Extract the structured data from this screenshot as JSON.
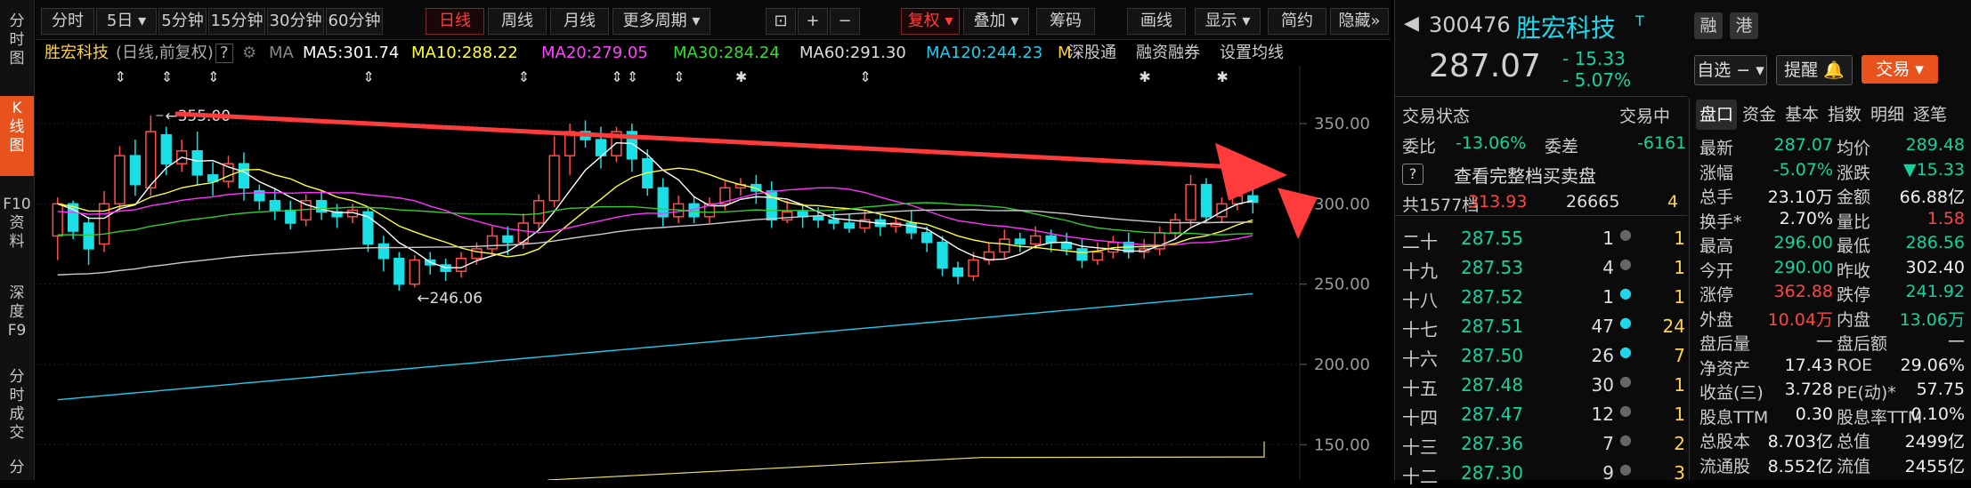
{
  "left_sidebar": [
    {
      "id": "fenshi",
      "label": [
        "分",
        "时",
        "图"
      ],
      "active": false
    },
    {
      "id": "kline",
      "label": [
        "K",
        "线",
        "图"
      ],
      "active": true
    },
    {
      "id": "f10",
      "label": [
        "F10",
        "资",
        "料"
      ],
      "active": false
    },
    {
      "id": "depth",
      "label": [
        "深",
        "度",
        "F9"
      ],
      "active": false
    },
    {
      "id": "deal",
      "label": [
        "分",
        "时",
        "成",
        "交"
      ],
      "active": false
    },
    {
      "id": "more",
      "label": [
        "分"
      ],
      "active": false
    }
  ],
  "toolbar": {
    "periods": [
      "分时",
      "5日",
      "5分钟",
      "15分钟",
      "30分钟",
      "60分钟",
      "日线",
      "周线",
      "月线",
      "更多周期"
    ],
    "active_period": "日线",
    "fuquan": "复权",
    "overlay": "叠加",
    "chips": "筹码",
    "draw": "画线",
    "display": "显示",
    "simplified": "简约",
    "hide": "隐藏"
  },
  "infobar": {
    "name": "胜宏科技",
    "mode": "(日线,前复权)",
    "help": "?",
    "ma_label": "MA",
    "ma5": "MA5:301.74",
    "ma10": "MA10:288.22",
    "ma20": "MA20:279.05",
    "ma30": "MA30:284.24",
    "ma60": "MA60:291.30",
    "ma120": "MA120:244.23",
    "ma_more": "M",
    "shengu": "深股通",
    "margin": "融资融券",
    "set_ma": "设置均线"
  },
  "chart_data": {
    "type": "candlestick",
    "y_ticks": [
      350.0,
      300.0,
      250.0,
      200.0,
      150.0
    ],
    "y_tick_labels": [
      "350.00",
      "300.00",
      "250.00",
      "200.00",
      "150.00"
    ],
    "ylim": [
      128,
      386
    ],
    "high_annotation": "355.00",
    "low_annotation": "246.06",
    "candles": [
      [
        280,
        300,
        265,
        304
      ],
      [
        300,
        283,
        278,
        302
      ],
      [
        288,
        272,
        262,
        292
      ],
      [
        275,
        300,
        270,
        308
      ],
      [
        300,
        330,
        296,
        336
      ],
      [
        330,
        312,
        305,
        340
      ],
      [
        310,
        345,
        305,
        355
      ],
      [
        343,
        325,
        318,
        348
      ],
      [
        325,
        333,
        320,
        340
      ],
      [
        333,
        318,
        312,
        345
      ],
      [
        318,
        314,
        305,
        326
      ],
      [
        314,
        325,
        310,
        330
      ],
      [
        325,
        310,
        302,
        332
      ],
      [
        308,
        302,
        296,
        312
      ],
      [
        302,
        296,
        290,
        310
      ],
      [
        296,
        288,
        284,
        302
      ],
      [
        290,
        302,
        286,
        306
      ],
      [
        302,
        295,
        290,
        308
      ],
      [
        295,
        292,
        285,
        300
      ],
      [
        292,
        296,
        288,
        300
      ],
      [
        295,
        275,
        270,
        298
      ],
      [
        275,
        266,
        258,
        280
      ],
      [
        266,
        250,
        246,
        270
      ],
      [
        250,
        265,
        248,
        268
      ],
      [
        265,
        262,
        256,
        270
      ],
      [
        262,
        258,
        252,
        266
      ],
      [
        258,
        266,
        254,
        270
      ],
      [
        266,
        272,
        262,
        276
      ],
      [
        272,
        280,
        268,
        286
      ],
      [
        280,
        276,
        268,
        286
      ],
      [
        276,
        288,
        272,
        294
      ],
      [
        288,
        302,
        284,
        306
      ],
      [
        302,
        330,
        298,
        342
      ],
      [
        330,
        345,
        318,
        350
      ],
      [
        345,
        340,
        335,
        352
      ],
      [
        340,
        330,
        322,
        348
      ],
      [
        330,
        345,
        326,
        348
      ],
      [
        345,
        328,
        320,
        350
      ],
      [
        328,
        310,
        305,
        334
      ],
      [
        310,
        292,
        286,
        316
      ],
      [
        292,
        300,
        288,
        305
      ],
      [
        300,
        292,
        288,
        304
      ],
      [
        292,
        300,
        288,
        304
      ],
      [
        300,
        310,
        296,
        314
      ],
      [
        310,
        312,
        305,
        316
      ],
      [
        312,
        308,
        300,
        318
      ],
      [
        308,
        290,
        285,
        314
      ],
      [
        290,
        295,
        288,
        302
      ],
      [
        295,
        292,
        285,
        300
      ],
      [
        292,
        290,
        285,
        298
      ],
      [
        290,
        288,
        284,
        296
      ],
      [
        288,
        285,
        282,
        294
      ],
      [
        285,
        290,
        282,
        296
      ],
      [
        290,
        286,
        280,
        294
      ],
      [
        286,
        288,
        282,
        292
      ],
      [
        288,
        282,
        278,
        296
      ],
      [
        282,
        276,
        270,
        286
      ],
      [
        276,
        260,
        255,
        280
      ],
      [
        260,
        255,
        250,
        264
      ],
      [
        255,
        265,
        252,
        270
      ],
      [
        265,
        270,
        262,
        276
      ],
      [
        270,
        278,
        266,
        284
      ],
      [
        278,
        275,
        270,
        282
      ],
      [
        275,
        280,
        272,
        286
      ],
      [
        280,
        276,
        270,
        284
      ],
      [
        276,
        272,
        268,
        282
      ],
      [
        272,
        265,
        260,
        278
      ],
      [
        265,
        270,
        262,
        276
      ],
      [
        270,
        276,
        266,
        280
      ],
      [
        276,
        270,
        266,
        282
      ],
      [
        270,
        272,
        266,
        278
      ],
      [
        272,
        282,
        268,
        286
      ],
      [
        282,
        290,
        278,
        294
      ],
      [
        290,
        312,
        286,
        318
      ],
      [
        312,
        292,
        288,
        316
      ],
      [
        292,
        300,
        288,
        304
      ],
      [
        300,
        305,
        296,
        312
      ],
      [
        305,
        301,
        294,
        310
      ]
    ],
    "ma_lines": {
      "MA5": {
        "color": "#ffffff"
      },
      "MA10": {
        "color": "#ffff33"
      },
      "MA20": {
        "color": "#ff33ff"
      },
      "MA30": {
        "color": "#33cc33"
      },
      "MA60": {
        "color": "#cccccc"
      },
      "MA120": {
        "color": "#22ccee"
      }
    }
  },
  "right": {
    "code": "300476",
    "name": "胜宏科技",
    "tag_t": "T",
    "rong": "融",
    "gang": "港",
    "price": "287.07",
    "change": "- 15.33",
    "change_pct": "- 5.07%",
    "watchlist": "自选",
    "alert": "提醒",
    "trade": "交易",
    "status_label": "交易状态",
    "status": "交易中",
    "weibi_label": "委比",
    "weibi": "-13.06%",
    "weicha_label": "委差",
    "weicha": "-6161",
    "full_book": "查看完整档买卖盘",
    "total_label": "共1577档",
    "total_price": "313.93",
    "total_vol": "26665",
    "total_n": "4",
    "tabs": [
      "盘口",
      "资金",
      "基本",
      "指数",
      "明细",
      "逐笔"
    ],
    "orderbook": [
      {
        "lvl": "二十",
        "price": "287.55",
        "vol": "1",
        "dot": "gray",
        "n": "1"
      },
      {
        "lvl": "十九",
        "price": "287.53",
        "vol": "4",
        "dot": "gray",
        "n": "1"
      },
      {
        "lvl": "十八",
        "price": "287.52",
        "vol": "1",
        "dot": "cyan",
        "n": "1"
      },
      {
        "lvl": "十七",
        "price": "287.51",
        "vol": "47",
        "dot": "cyan",
        "n": "24"
      },
      {
        "lvl": "十六",
        "price": "287.50",
        "vol": "26",
        "dot": "cyan",
        "n": "7"
      },
      {
        "lvl": "十五",
        "price": "287.48",
        "vol": "30",
        "dot": "gray",
        "n": "1"
      },
      {
        "lvl": "十四",
        "price": "287.47",
        "vol": "12",
        "dot": "gray",
        "n": "1"
      },
      {
        "lvl": "十三",
        "price": "287.36",
        "vol": "7",
        "dot": "gray",
        "n": "2"
      },
      {
        "lvl": "十二",
        "price": "287.30",
        "vol": "9",
        "dot": "gray",
        "n": "3"
      }
    ],
    "stats": [
      {
        "l1": "最新",
        "v1": "287.07",
        "c1": "green",
        "l2": "均价",
        "v2": "289.48",
        "c2": "green"
      },
      {
        "l1": "涨幅",
        "v1": "-5.07%",
        "c1": "green",
        "l2": "涨跌",
        "v2": "▼15.33",
        "c2": "green"
      },
      {
        "l1": "总手",
        "v1": "23.10万",
        "c1": "white",
        "l2": "金额",
        "v2": "66.88亿",
        "c2": "white"
      },
      {
        "l1": "换手*",
        "v1": "2.70%",
        "c1": "white",
        "l2": "量比",
        "v2": "1.58",
        "c2": "red"
      },
      {
        "l1": "最高",
        "v1": "296.00",
        "c1": "green",
        "l2": "最低",
        "v2": "286.56",
        "c2": "green"
      },
      {
        "l1": "今开",
        "v1": "290.00",
        "c1": "green",
        "l2": "昨收",
        "v2": "302.40",
        "c2": "white"
      },
      {
        "l1": "涨停",
        "v1": "362.88",
        "c1": "red",
        "l2": "跌停",
        "v2": "241.92",
        "c2": "green"
      },
      {
        "l1": "外盘",
        "v1": "10.04万",
        "c1": "red",
        "l2": "内盘",
        "v2": "13.06万",
        "c2": "green"
      },
      {
        "l1": "盘后量",
        "v1": "—",
        "c1": "white",
        "l2": "盘后额",
        "v2": "—",
        "c2": "white"
      },
      {
        "l1": "净资产",
        "v1": "17.43",
        "c1": "white",
        "l2": "ROE",
        "v2": "29.06%",
        "c2": "white"
      },
      {
        "l1": "收益(三)",
        "v1": "3.728",
        "c1": "white",
        "l2": "PE(动)*",
        "v2": "57.75",
        "c2": "white"
      },
      {
        "l1": "股息TTM",
        "v1": "0.30",
        "c1": "white",
        "l2": "股息率TTM",
        "v2": "0.10%",
        "c2": "white"
      },
      {
        "l1": "总股本",
        "v1": "8.703亿",
        "c1": "white",
        "l2": "总值",
        "v2": "2499亿",
        "c2": "white"
      },
      {
        "l1": "流通股",
        "v1": "8.552亿",
        "c1": "white",
        "l2": "流值",
        "v2": "2455亿",
        "c2": "white"
      }
    ]
  }
}
